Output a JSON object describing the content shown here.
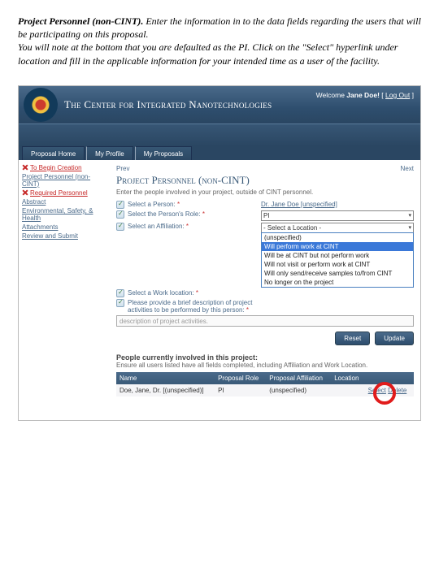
{
  "instructions": {
    "title": "Project Personnel (non-CINT).",
    "body1": " Enter the information in to the data fields regarding the users that will be participating on this proposal.",
    "body2": "You will note at the bottom that you are defaulted as the PI. Click on the \"Select\" hyperlink under location and fill in the applicable information for your intended time as a user of the facility."
  },
  "header": {
    "title": "The Center for Integrated Nanotechnologies",
    "welcome_prefix": "Welcome ",
    "welcome_user": "Jane Doe!",
    "logout": "Log Out"
  },
  "tabs": [
    "Proposal Home",
    "My Profile",
    "My Proposals"
  ],
  "sidebar": {
    "items": [
      {
        "icon": "x",
        "text": "To Begin Creation",
        "cls": "sb-red",
        "interact": false
      },
      {
        "icon": "",
        "text": "Project Personnel (non-CINT)",
        "cls": "sb-link",
        "interact": true
      },
      {
        "icon": "x",
        "text": "Required Personnel",
        "cls": "sb-red",
        "interact": false
      },
      {
        "icon": "",
        "text": "Abstract",
        "cls": "sb-link",
        "interact": true
      },
      {
        "icon": "",
        "text": "Environmental, Safety, & Health",
        "cls": "sb-link",
        "interact": true
      },
      {
        "icon": "",
        "text": "Attachments",
        "cls": "sb-link",
        "interact": true
      },
      {
        "icon": "",
        "text": "Review and Submit",
        "cls": "sb-link",
        "interact": true
      }
    ]
  },
  "content": {
    "prev": "Prev",
    "next": "Next",
    "section_title": "Project Personnel (non-CINT)",
    "subtext": "Enter the people involved in your project, outside of CINT personnel.",
    "rows": [
      {
        "label": "Select a Person:",
        "req": "*",
        "value_type": "userlink",
        "value": "Dr. Jane Doe [unspecified]"
      },
      {
        "label": "Select the Person's Role:",
        "req": "*",
        "value_type": "select",
        "value": "PI"
      },
      {
        "label": "Select an Affiliation:",
        "req": "*",
        "value_type": "dropdown",
        "value": "- Select a Location -",
        "options": [
          "(unspecified)",
          "Will perform work at CINT",
          "Will be at CINT but not perform work",
          "Will not visit or perform work at CINT",
          "Will only send/receive samples to/from CINT",
          "No longer on the project"
        ],
        "selected_index": 1
      },
      {
        "label": "Select a Work location:",
        "req": "*",
        "value_type": "blank",
        "value": ""
      },
      {
        "label": "Please provide a brief description of project activities to be performed by this person:",
        "req": "*",
        "value_type": "textarea",
        "value": "description of project activities."
      }
    ],
    "buttons": {
      "reset": "Reset",
      "update": "Update"
    },
    "people_title": "People currently involved in this project:",
    "people_sub": "Ensure all users listed have all fields completed, including Affiliation and Work Location.",
    "columns": [
      "Name",
      "Proposal Role",
      "Proposal Affiliation",
      "Location"
    ],
    "people": [
      {
        "name": "Doe, Jane, Dr. [(unspecified)]",
        "role": "PI",
        "affil": "(unspecified)",
        "loc": "",
        "select": "Select",
        "del": "Delete"
      }
    ]
  }
}
